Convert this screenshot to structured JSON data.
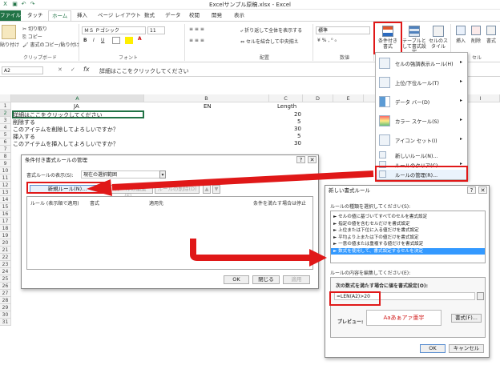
{
  "window": {
    "title": "Excelサンプル原稿.xlsx - Excel"
  },
  "tabs": {
    "file": "ファイル",
    "items": [
      "タッチ",
      "ホーム",
      "挿入",
      "ページ レイアウト",
      "数式",
      "データ",
      "校閲",
      "開発",
      "表示"
    ]
  },
  "ribbon": {
    "paste": "貼り付け",
    "cut": "切り取り",
    "copy": "コピー",
    "format_painter": "書式のコピー/貼り付け",
    "clipboard_group": "クリップボード",
    "font_name": "ＭＳ Ｐゴシック",
    "font_size": "11",
    "bold": "B",
    "italic": "I",
    "underline": "U",
    "font_group": "フォント",
    "wrap_text": "折り返して全体を表示する",
    "merge_center": "セルを結合して中央揃え",
    "alignment_group": "配置",
    "number_format": "標準",
    "number_group": "数値",
    "cond_format": "条件付き書式",
    "table_format": "テーブルとして書式設定",
    "cell_styles": "セルのスタイル",
    "insert": "挿入",
    "delete": "削除",
    "format": "書式",
    "cells_group": "セル"
  },
  "formula_bar": {
    "name_box": "A2",
    "fx": "fx",
    "content": "詳細はここをクリックしてください"
  },
  "sheet": {
    "columns": [
      "A",
      "B",
      "C",
      "D",
      "E",
      "F",
      "G",
      "H",
      "I"
    ],
    "rows": [
      "1",
      "2",
      "3",
      "4",
      "5",
      "6",
      "7",
      "8",
      "9",
      "10",
      "11",
      "12",
      "13",
      "14",
      "15",
      "16",
      "17",
      "18",
      "19",
      "20",
      "21",
      "22",
      "23",
      "24",
      "25",
      "26",
      "27",
      "28",
      "29",
      "30",
      "31"
    ],
    "header": {
      "a": "JA",
      "b": "EN",
      "c": "Length"
    },
    "data": [
      {
        "a": "詳細はここをクリックしてください",
        "c": "20"
      },
      {
        "a": "削除する",
        "c": "5"
      },
      {
        "a": "このアイテムを削除してよろしいですか？",
        "c": "30"
      },
      {
        "a": "挿入する",
        "c": "5"
      },
      {
        "a": "このアイテムを挿入してよろしいですか？",
        "c": "30"
      }
    ]
  },
  "cf_menu": {
    "items": [
      {
        "label": "セルの強調表示ルール(H)"
      },
      {
        "label": "上位/下位ルール(T)"
      },
      {
        "label": "データ バー(D)"
      },
      {
        "label": "カラー スケール(S)"
      },
      {
        "label": "アイコン セット(I)"
      }
    ],
    "small": [
      "新しいルール(N)...",
      "ルールのクリア(C)",
      "ルールの管理(R)..."
    ]
  },
  "manager_dialog": {
    "title": "条件付き書式ルールの管理",
    "scope_label": "書式ルールの表示(S):",
    "scope_value": "現在の選択範囲",
    "new_rule": "新規ルール(N)...",
    "edit_rule": "ルールの編集(E)...",
    "delete_rule": "ルールの削除(D)",
    "col_rule": "ルール (表示順で適用)",
    "col_format": "書式",
    "col_applies": "適用先",
    "col_stop": "条件を満たす場合は停止",
    "ok": "OK",
    "close": "閉じる",
    "apply": "適用"
  },
  "new_rule_dialog": {
    "title": "新しい書式ルール",
    "type_label": "ルールの種類を選択してください(S):",
    "types": [
      "► セルの値に基づいてすべてのセルを書式設定",
      "► 指定の値を含むセルだけを書式設定",
      "► 上位または下位に入る値だけを書式設定",
      "► 平均より上または下の値だけを書式設定",
      "► 一意の値または重複する値だけを書式設定",
      "► 数式を使用して、書式設定するセルを決定"
    ],
    "edit_label": "ルールの内容を編集してください(E):",
    "formula_label": "次の数式を満たす場合に値を書式設定(O):",
    "formula": "=LEN(A2)>20",
    "preview_label": "プレビュー:",
    "preview_text": "Aaあぁアァ亜宇",
    "format_btn": "書式(F)...",
    "ok": "OK",
    "cancel": "キャンセル"
  },
  "colors": {
    "excel_green": "#217346",
    "highlight_red": "#e01818",
    "arrow_red": "#e01818",
    "selected_blue": "#3399ff"
  }
}
